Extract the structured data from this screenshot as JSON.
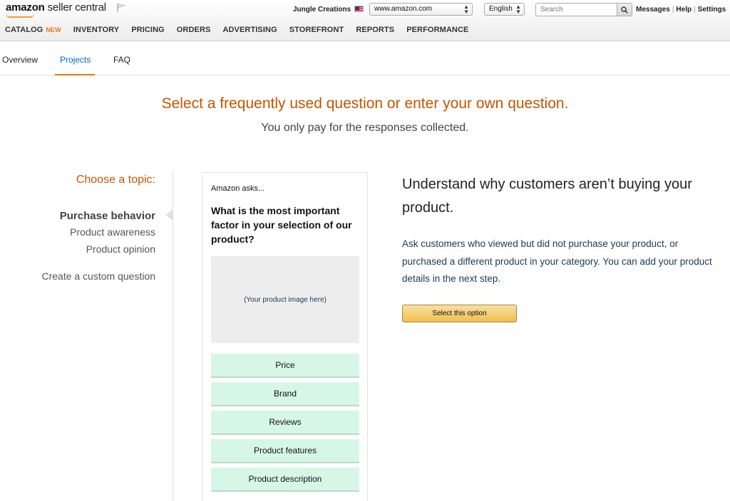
{
  "header": {
    "logo_brand": "amazon",
    "logo_product": "seller central",
    "store_name": "Jungle Creations",
    "marketplace": "www.amazon.com",
    "language": "English",
    "search_placeholder": "Search",
    "links": [
      "Messages",
      "Help",
      "Settings"
    ],
    "accent_color": "#e47911"
  },
  "nav": {
    "items": [
      "CATALOG",
      "INVENTORY",
      "PRICING",
      "ORDERS",
      "ADVERTISING",
      "STOREFRONT",
      "REPORTS",
      "PERFORMANCE"
    ],
    "new_badge": "NEW"
  },
  "subtabs": {
    "items": [
      "Overview",
      "Projects",
      "FAQ"
    ],
    "active": "Projects"
  },
  "main": {
    "heading": "Select a frequently used question or enter your own question.",
    "subheading": "You only pay for the responses collected."
  },
  "topics": {
    "title": "Choose a topic:",
    "active": "Purchase behavior",
    "items": [
      "Product awareness",
      "Product opinion"
    ],
    "custom": "Create a custom question"
  },
  "card": {
    "asks": "Amazon asks...",
    "question": "What is the most important factor in your selection of our product?",
    "image_placeholder": "(Your product image here)",
    "options": [
      "Price",
      "Brand",
      "Reviews",
      "Product features",
      "Product description"
    ]
  },
  "info": {
    "title": "Understand why customers aren’t buying your product.",
    "description": "Ask customers who viewed but did not purchase your product, or purchased a different product in your category. You can add your product details in the next step.",
    "button_label": "Select this option"
  }
}
